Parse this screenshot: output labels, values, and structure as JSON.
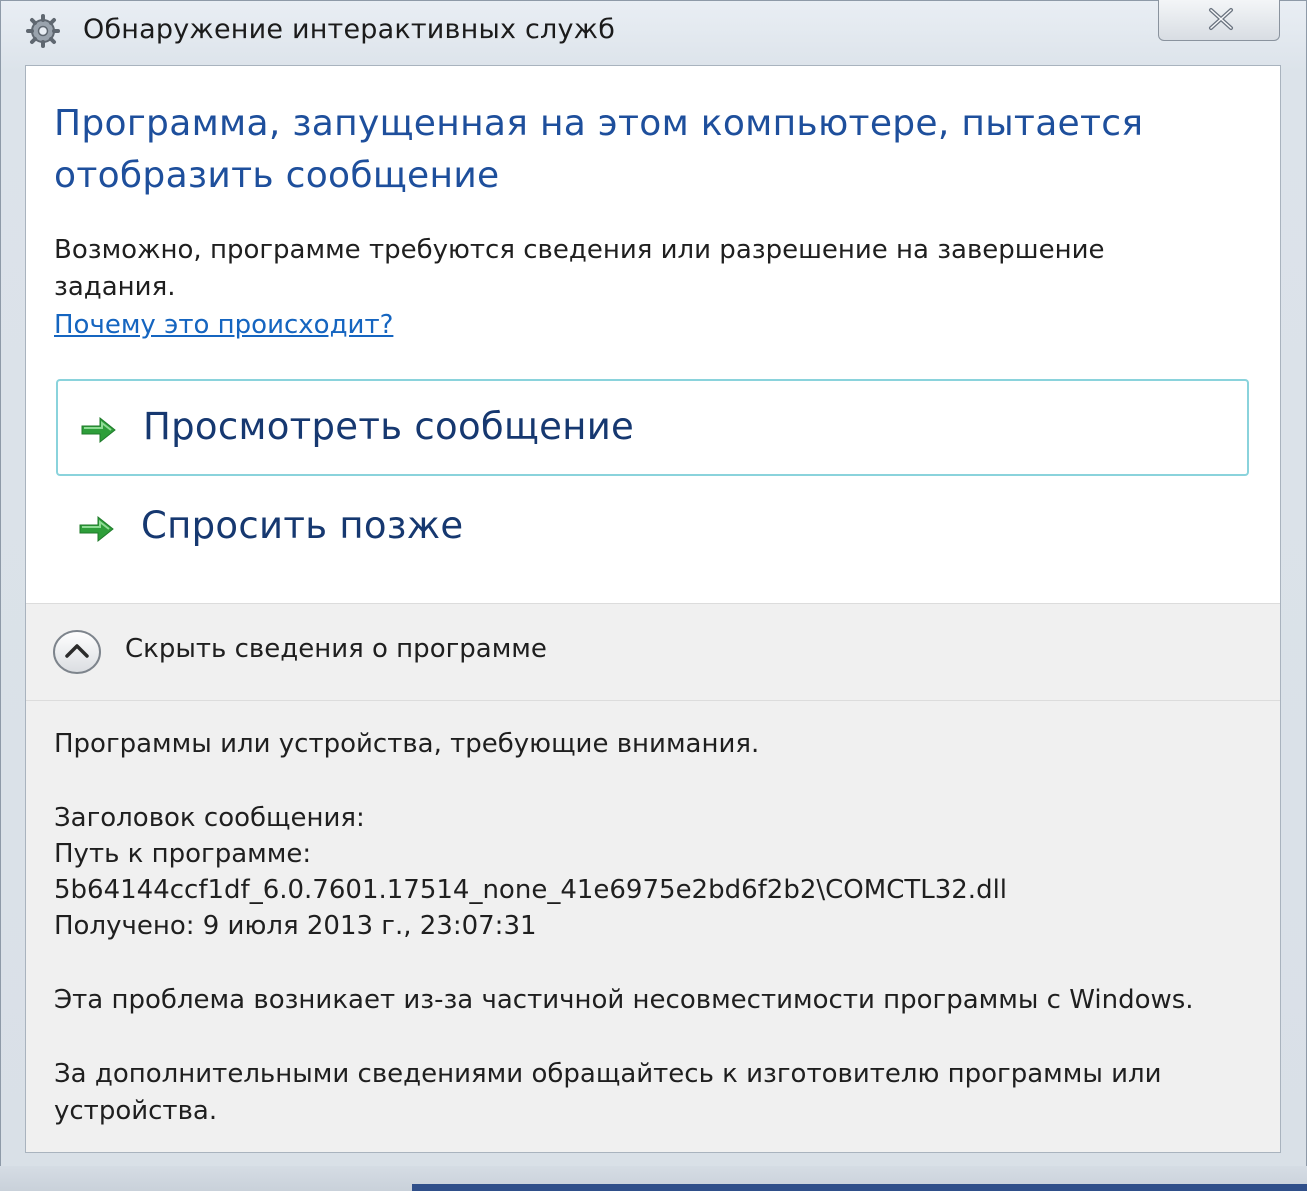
{
  "window": {
    "title": "Обнаружение интерактивных служб",
    "icons": {
      "app": "services-gear-icon",
      "close": "close-icon"
    }
  },
  "main": {
    "heading": "Программа, запущенная на этом компьютере, пытается отобразить сообщение",
    "description": "Возможно, программе требуются сведения или разрешение на завершение задания.",
    "why_link": "Почему это происходит?",
    "commands": [
      {
        "label": "Просмотреть сообщение",
        "icon": "green-arrow-icon"
      },
      {
        "label": "Спросить позже",
        "icon": "green-arrow-icon"
      }
    ]
  },
  "expander": {
    "label": "Скрыть сведения о программе",
    "icon": "chevron-up-icon"
  },
  "details": {
    "intro": "Программы или устройства, требующие внимания.",
    "message_title": "Заголовок сообщения:",
    "program_path_label": "Путь к программе:",
    "program_path": "5b64144ccf1df_6.0.7601.17514_none_41e6975e2bd6f2b2\\COMCTL32.dll",
    "received": "Получено:  9 июля 2013 г., 23:07:31",
    "problem": "Эта проблема возникает из-за частичной несовместимости программы с Windows.",
    "contact": "За дополнительными сведениями обращайтесь к изготовителю программы или устройства."
  },
  "colors": {
    "heading": "#1e4f9c",
    "link": "#1565c0",
    "command": "#163870",
    "arrow": "#2e9e3a",
    "selection_border": "#8ad3dc"
  }
}
